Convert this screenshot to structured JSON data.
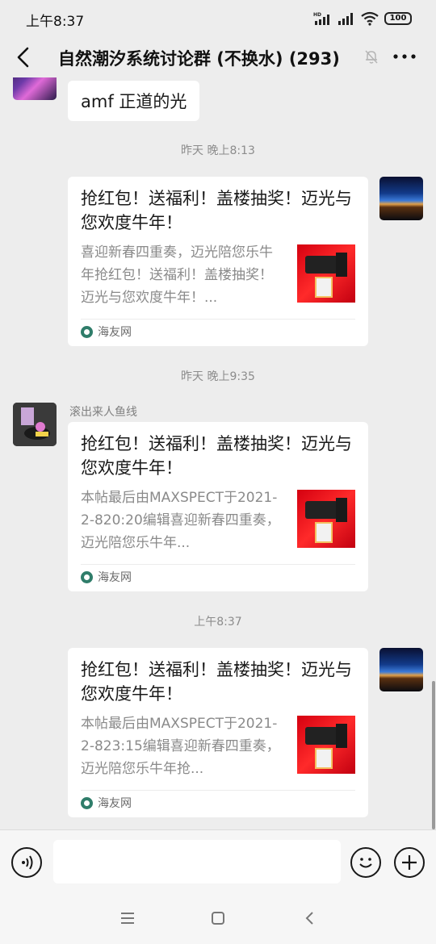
{
  "status_bar": {
    "time": "上午8:37",
    "battery": "100",
    "signal_label": "HD"
  },
  "nav": {
    "title": "自然潮汐系统讨论群 (不换水) (293)",
    "back_icon": "chevron-left-icon",
    "mute_icon": "bell-off-icon",
    "more_icon": "more-dots-icon"
  },
  "messages": [
    {
      "type": "text",
      "text": "amf 正道的光"
    },
    {
      "type": "timestamp",
      "text": "昨天 晚上8:13"
    },
    {
      "type": "link_card",
      "side": "right",
      "title": "抢红包！送福利！盖楼抽奖！迈光与您欢度牛年！",
      "desc": "喜迎新春四重奏，迈光陪您乐牛年抢红包！送福利！盖楼抽奖！迈光与您欢度牛年！...",
      "source": "海友网"
    },
    {
      "type": "timestamp",
      "text": "昨天 晚上9:35"
    },
    {
      "type": "link_card",
      "side": "left",
      "sender": "滚出来人鱼线",
      "title": "抢红包！送福利！盖楼抽奖！迈光与您欢度牛年！",
      "desc": "本帖最后由MAXSPECT于2021-2-820:20编辑喜迎新春四重奏，迈光陪您乐牛年...",
      "source": "海友网"
    },
    {
      "type": "timestamp",
      "text": "上午8:37"
    },
    {
      "type": "link_card",
      "side": "right",
      "title": "抢红包！送福利！盖楼抽奖！迈光与您欢度牛年！",
      "desc": "本帖最后由MAXSPECT于2021-2-823:15编辑喜迎新春四重奏，迈光陪您乐牛年抢...",
      "source": "海友网"
    }
  ],
  "input_bar": {
    "voice_icon": "voice-icon",
    "placeholder": "",
    "emoji_icon": "emoji-icon",
    "plus_icon": "plus-icon"
  },
  "system_nav": {
    "menu_icon": "menu-icon",
    "home_icon": "home-square-icon",
    "back_icon": "back-triangle-icon"
  }
}
